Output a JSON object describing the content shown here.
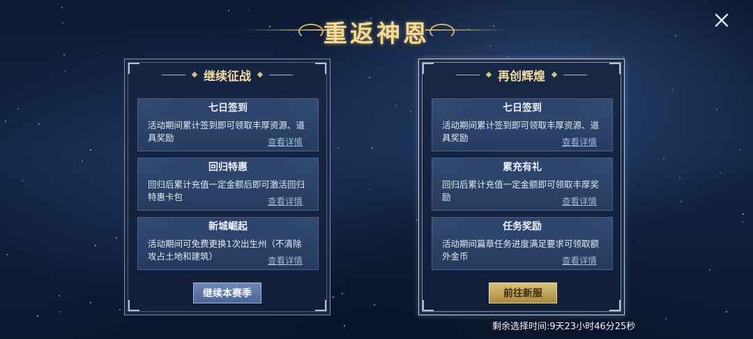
{
  "title": "重返神恩",
  "icons": {
    "close": "close-icon"
  },
  "colors": {
    "title_gold": "#f1d99a",
    "button_gold": "#d9c27c",
    "button_blue": "#6f87b4",
    "link": "#9fb9db"
  },
  "panels": [
    {
      "title": "继续征战",
      "selected": false,
      "cards": [
        {
          "title": "七日签到",
          "desc": "活动期间累计签到即可领取丰厚资源、道具奖励",
          "link": "查看详情"
        },
        {
          "title": "回归特惠",
          "desc": "回归后累计充值一定金额后即可激活回归特惠卡包",
          "link": "查看详情"
        },
        {
          "title": "新城崛起",
          "desc": "活动期间可免费更换1次出生州（不清除攻占土地和建筑）",
          "link": "查看详情"
        }
      ],
      "button": "继续本赛季"
    },
    {
      "title": "再创辉煌",
      "selected": true,
      "cards": [
        {
          "title": "七日签到",
          "desc": "活动期间累计签到即可领取丰厚资源、道具奖励",
          "link": "查看详情"
        },
        {
          "title": "累充有礼",
          "desc": "回归后累计充值一定金额即可领取丰厚奖励",
          "link": "查看详情"
        },
        {
          "title": "任务奖励",
          "desc": "活动期间篇章任务进度满足要求可领取额外金币",
          "link": "查看详情"
        }
      ],
      "button": "前往新服"
    }
  ],
  "timer": "剩余选择时间:9天23小时46分25秒"
}
